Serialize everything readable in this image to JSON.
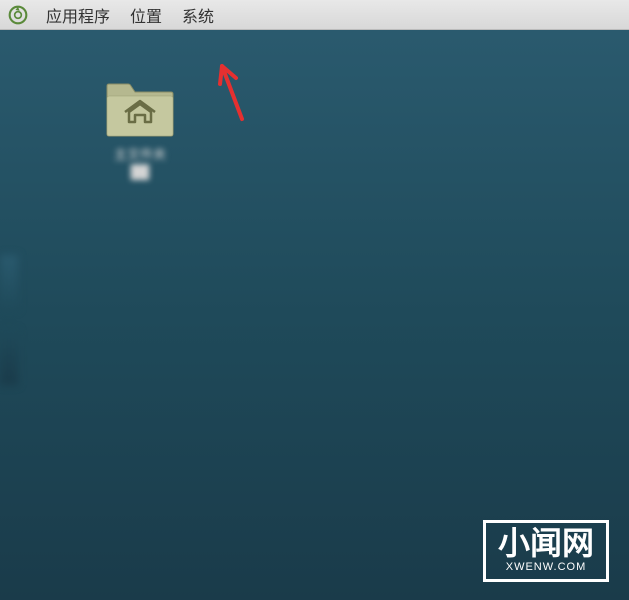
{
  "menubar": {
    "applications": "应用程序",
    "places": "位置",
    "system": "系统"
  },
  "desktop": {
    "home_folder_label": "主文件夹",
    "home_folder_label2": ""
  },
  "watermark": {
    "main": "小闻网",
    "sub": "XWENW.COM"
  }
}
